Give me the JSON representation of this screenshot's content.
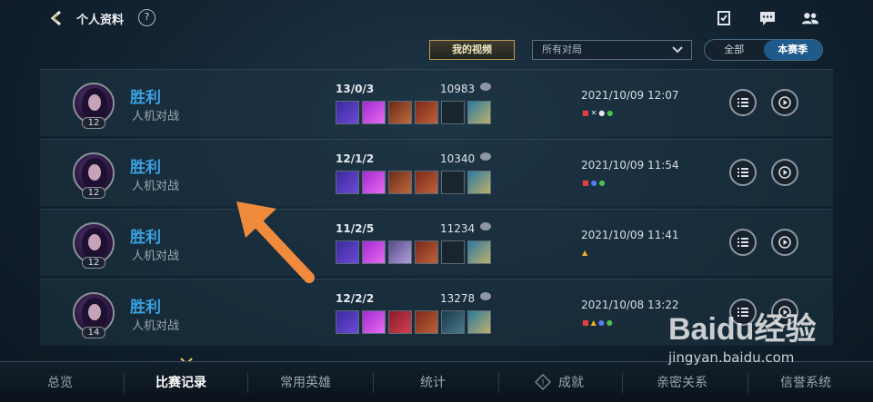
{
  "header": {
    "title": "个人资料",
    "help": "?",
    "icons": [
      "checklist-icon",
      "chat-icon",
      "friends-icon"
    ]
  },
  "filters": {
    "my_video": "我的视频",
    "select_value": "所有对局",
    "seg_all": "全部",
    "seg_season": "本赛季"
  },
  "matches": [
    {
      "level": "12",
      "result": "胜利",
      "mode": "人机对战",
      "kda": "13/0/3",
      "gold": "10983",
      "date": "2021/10/09 12:07"
    },
    {
      "level": "12",
      "result": "胜利",
      "mode": "人机对战",
      "kda": "12/1/2",
      "gold": "10340",
      "date": "2021/10/09 11:54"
    },
    {
      "level": "12",
      "result": "胜利",
      "mode": "人机对战",
      "kda": "11/2/5",
      "gold": "11234",
      "date": "2021/10/09 11:41"
    },
    {
      "level": "14",
      "result": "胜利",
      "mode": "人机对战",
      "kda": "12/2/2",
      "gold": "13278",
      "date": "2021/10/08 13:22"
    }
  ],
  "tabs": [
    "总览",
    "比赛记录",
    "常用英雄",
    "统计",
    "成就",
    "亲密关系",
    "信誉系统"
  ],
  "active_tab": "比赛记录",
  "watermark": {
    "logo": "Baidu经验",
    "url": "jingyan.baidu.com"
  },
  "colors": {
    "accent": "#3aa2e2",
    "gold": "#b79a55",
    "arrow": "#f08a3c"
  }
}
